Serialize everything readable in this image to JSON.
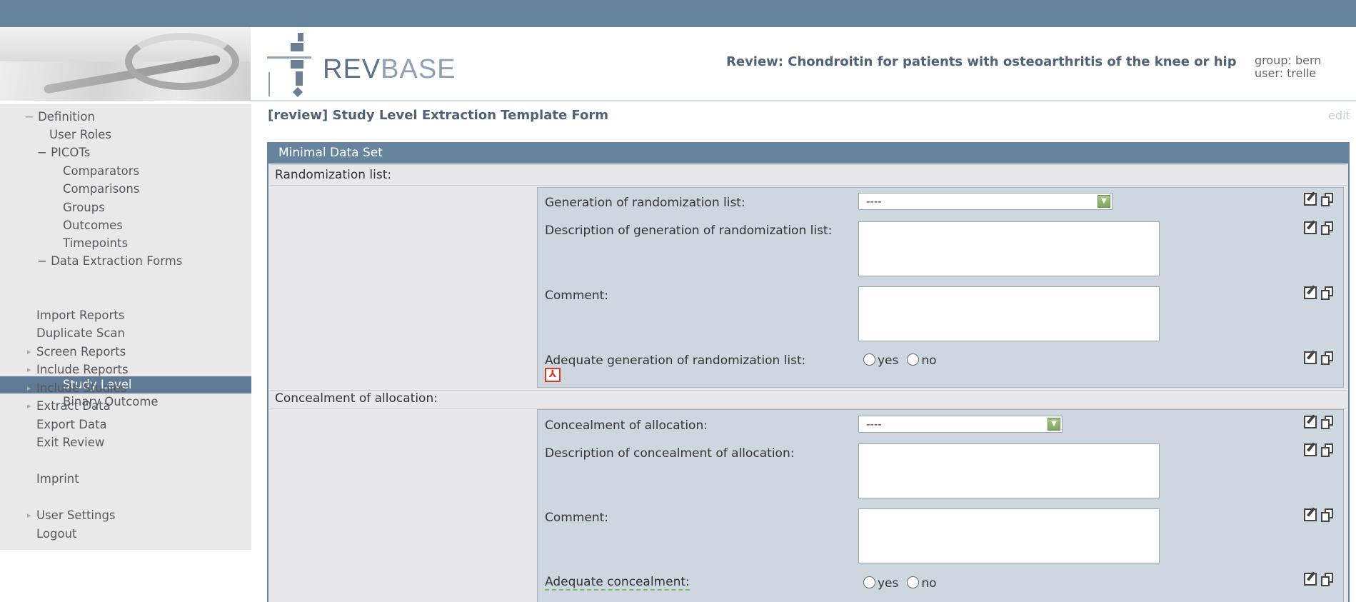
{
  "header": {
    "logo_text_a": "REV",
    "logo_text_b": "BASE",
    "review_title": "Review: Chondroitin for patients with osteoarthritis of the knee or hip",
    "group": "group: bern",
    "user": "user: trelle"
  },
  "sidebar": {
    "items": [
      {
        "label": "Definition",
        "prefix": "−"
      },
      {
        "label": "User Roles"
      },
      {
        "label": "PICOTs",
        "prefix": "−"
      },
      {
        "label": "Comparators"
      },
      {
        "label": "Comparisons"
      },
      {
        "label": "Groups"
      },
      {
        "label": "Outcomes"
      },
      {
        "label": "Timepoints"
      },
      {
        "label": "Data Extraction Forms",
        "prefix": "−"
      },
      {
        "label": "Study Level",
        "selected": true
      },
      {
        "label": "Binary Outcome"
      },
      {
        "label": "Import Reports"
      },
      {
        "label": "Duplicate Scan"
      },
      {
        "label": "Screen Reports"
      },
      {
        "label": "Include Reports"
      },
      {
        "label": "Include Studies"
      },
      {
        "label": "Extract Data"
      },
      {
        "label": "Export Data"
      },
      {
        "label": "Exit Review"
      },
      {
        "label": "Imprint"
      },
      {
        "label": "User Settings"
      },
      {
        "label": "Logout"
      }
    ],
    "minus_glyph": "−"
  },
  "main": {
    "form_title": "[review] Study Level Extraction Template Form",
    "edit_label": "edit",
    "panel_title": "Minimal Data Set",
    "sections": [
      {
        "label": "Randomization list:",
        "fields": {
          "generation_label": "Generation of randomization list:",
          "generation_value": "----",
          "description_label": "Description of generation of randomization list:",
          "comment_label": "Comment:",
          "adequate_label": "Adequate generation of randomization list:",
          "yes": "yes",
          "no": "no"
        }
      },
      {
        "label": "Concealment of allocation:",
        "fields": {
          "concealment_label": "Concealment of allocation:",
          "concealment_value": "----",
          "description_label": "Description of concealment of allocation:",
          "comment_label": "Comment:",
          "adequate_label": "Adequate concealment:",
          "yes": "yes",
          "no": "no"
        }
      }
    ]
  },
  "icons": {
    "edit": "edit-icon",
    "copy": "copy-icon",
    "pdf": "pdf-icon",
    "dropdown": "chevron-down-icon"
  },
  "colors": {
    "topbar": "#67849f",
    "selected": "#5f7a94",
    "block_bg": "#ced6df",
    "title": "#4f6278"
  }
}
